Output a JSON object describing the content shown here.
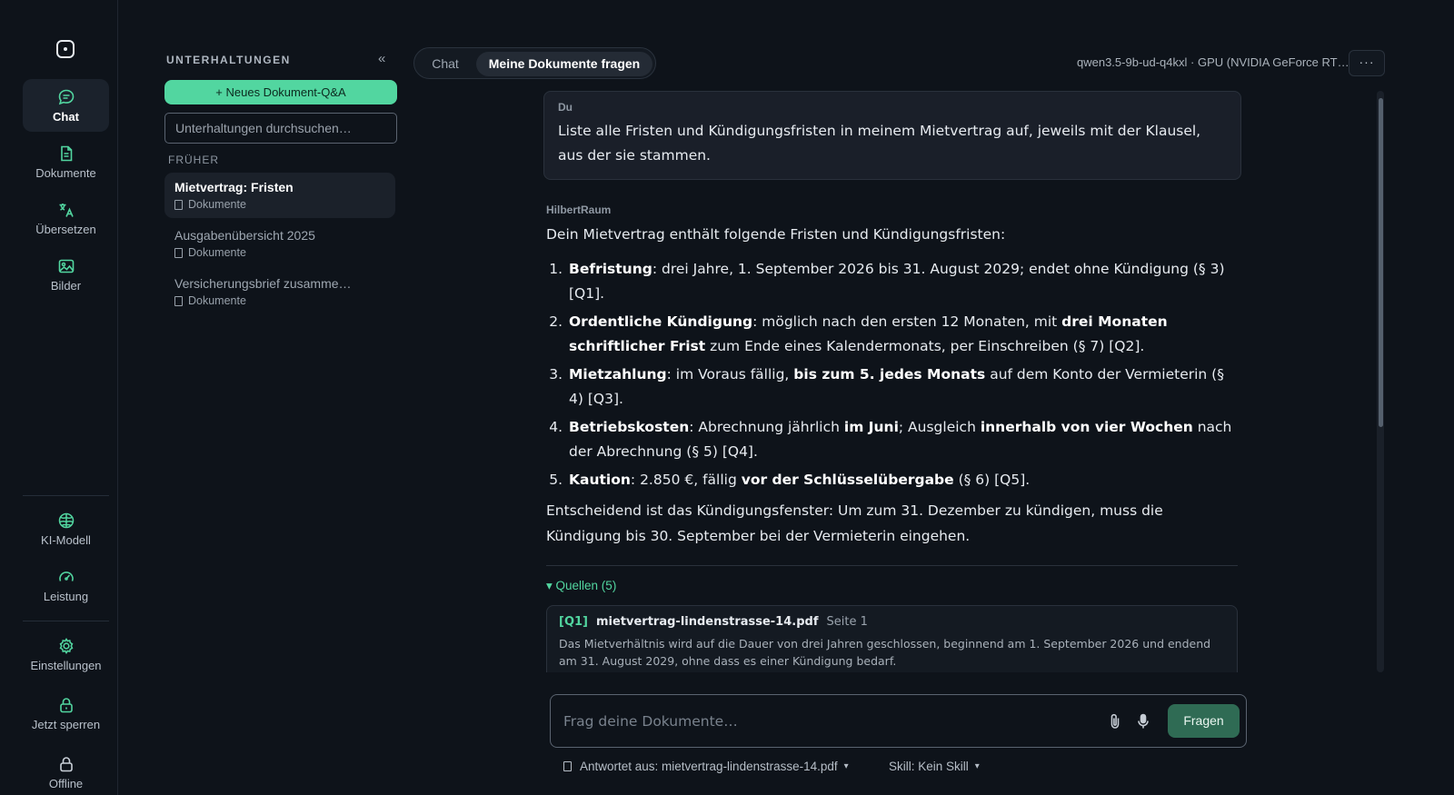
{
  "rail": {
    "items": [
      {
        "label": "Chat",
        "icon": "chat-bubble-icon"
      },
      {
        "label": "Dokumente",
        "icon": "document-icon"
      },
      {
        "label": "Übersetzen",
        "icon": "translate-icon"
      },
      {
        "label": "Bilder",
        "icon": "image-icon"
      },
      {
        "label": "KI-Modell",
        "icon": "brain-icon"
      },
      {
        "label": "Leistung",
        "icon": "gauge-icon"
      },
      {
        "label": "Einstellungen",
        "icon": "gear-icon"
      },
      {
        "label": "Jetzt sperren",
        "icon": "lock-icon"
      },
      {
        "label": "Offline",
        "icon": "lock-icon"
      }
    ],
    "accent": "#52d6a0"
  },
  "conversations": {
    "title": "UNTERHALTUNGEN",
    "collapse": "«",
    "new_button": "+ Neues Dokument-Q&A",
    "search_placeholder": "Unterhaltungen durchsuchen…",
    "section": "FRÜHER",
    "items": [
      {
        "name": "Mietvertrag: Fristen",
        "sub": "Dokumente"
      },
      {
        "name": "Ausgabenübersicht 2025",
        "sub": "Dokumente"
      },
      {
        "name": "Versicherungsbrief zusamme…",
        "sub": "Dokumente"
      }
    ]
  },
  "header": {
    "tabs": [
      "Chat",
      "Meine Dokumente fragen"
    ],
    "model": "qwen3.5-9b-ud-q4kxl · GPU (NVIDIA GeForce RT…",
    "more": "···"
  },
  "chat": {
    "user_name": "Du",
    "user_text": "Liste alle Fristen und Kündigungsfristen in meinem Mietvertrag auf, jeweils mit der Klausel, aus der sie stammen.",
    "assistant_name": "HilbertRaum",
    "intro": "Dein Mietvertrag enthält folgende Fristen und Kündigungsfristen:",
    "items": [
      {
        "t1": "Befristung",
        "t2": ": drei Jahre, 1. September 2026 bis 31. August 2029; endet ohne Kündigung (§ 3) [Q1]."
      },
      {
        "t1": "Ordentliche Kündigung",
        "t2": ": möglich nach den ersten 12 Monaten, mit ",
        "t3": "drei Monaten schriftlicher Frist",
        "t4": " zum Ende eines Kalendermonats, per Einschreiben (§ 7) [Q2]."
      },
      {
        "t1": "Mietzahlung",
        "t2": ": im Voraus fällig, ",
        "t3": "bis zum 5. jedes Monats",
        "t4": " auf dem Konto der Vermieterin (§ 4) [Q3]."
      },
      {
        "t1": "Betriebskosten",
        "t2": ": Abrechnung jährlich ",
        "t3": "im Juni",
        "t4": "; Ausgleich ",
        "t5": "innerhalb von vier Wochen",
        "t6": " nach der Abrechnung (§ 5) [Q4]."
      },
      {
        "t1": "Kaution",
        "t2": ": 2.850 €, fällig ",
        "t3": "vor der Schlüsselübergabe",
        "t4": " (§ 6) [Q5]."
      }
    ],
    "outro": "Entscheidend ist das Kündigungsfenster: Um zum 31. Dezember zu kündigen, muss die Kündigung bis 30. September bei der Vermieterin eingehen.",
    "sources_toggle": "▾ Quellen (5)",
    "source": {
      "id": "[Q1]",
      "file": "mietvertrag-lindenstrasse-14.pdf",
      "page": "Seite 1",
      "text": "Das Mietverhältnis wird auf die Dauer von drei Jahren geschlossen, beginnend am 1. September 2026 und endend am 31. August 2029, ohne dass es einer Kündigung bedarf."
    }
  },
  "composer": {
    "placeholder": "Frag deine Dokumente…",
    "ask": "Fragen",
    "answers_from": "Antwortet aus: mietvertrag-lindenstrasse-14.pdf",
    "skill": "Skill: Kein Skill",
    "caret": "▾"
  }
}
